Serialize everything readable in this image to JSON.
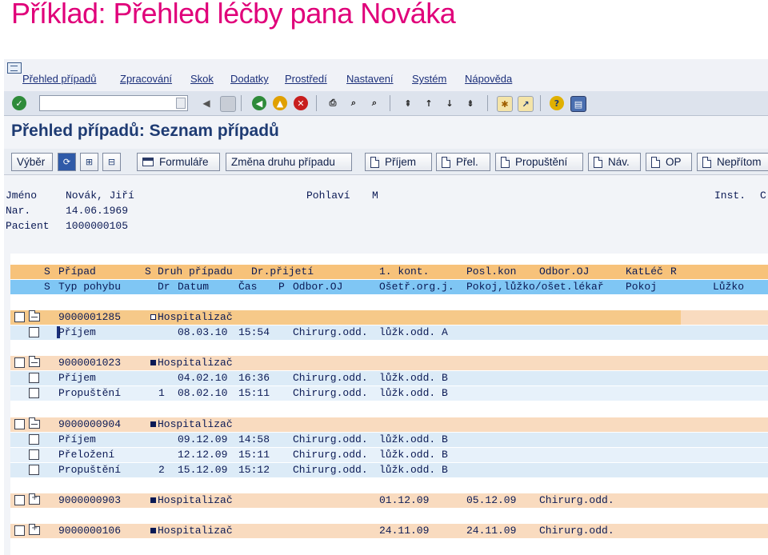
{
  "slide_title": "Příklad: Přehled léčby pana Nováka",
  "menu": [
    "Přehled případů",
    "Zpracování",
    "Skok",
    "Dodatky",
    "Prostředí",
    "Nastavení",
    "Systém",
    "Nápověda"
  ],
  "command_field": {
    "value": ""
  },
  "screen_title": "Přehled případů: Seznam případů",
  "app_toolbar": {
    "vyber": "Výběr",
    "formulare": "Formuláře",
    "zmena": "Změna druhu případu",
    "prijem": "Příjem",
    "prel": "Přel.",
    "propusteni": "Propuštění",
    "nav": "Náv.",
    "op": "OP",
    "nepritom": "Nepřítom"
  },
  "patient": {
    "name_label": "Jméno",
    "name": "Novák, Jiří",
    "sex_label": "Pohlaví",
    "sex": "M",
    "inst_label": "Inst.",
    "inst_value": "C",
    "dob_label": "Nar.",
    "dob": "14.06.1969",
    "patient_label": "Pacient",
    "patient_id": "1000000105"
  },
  "header_row1": [
    "S",
    "Případ",
    "S",
    "Druh případu",
    "Dr.přijetí",
    "1. kont.",
    "Posl.kon",
    "Odbor.OJ",
    "KatLéč",
    "R"
  ],
  "header_row2": [
    "S",
    "Typ pohybu",
    "Dr",
    "Datum",
    "Čas",
    "P",
    "Odbor.OJ",
    "Ošetř.org.j.",
    "Pokoj,lůžko/ošet.lékař",
    "Pokoj",
    "Lůžko"
  ],
  "cases": [
    {
      "id": "9000001285",
      "type": "Hospitalizač",
      "dr_prijeti": "",
      "kont": "",
      "posl": "",
      "movements": [
        {
          "typ": "Příjem",
          "p": "",
          "datum": "08.03.10",
          "cas": "15:54",
          "odbor": "Chirurg.odd.",
          "oset": "lůžk.odd. A"
        }
      ]
    },
    {
      "id": "9000001023",
      "type": "Hospitalizač",
      "dr_prijeti": "",
      "kont": "",
      "posl": "",
      "movements": [
        {
          "typ": "Příjem",
          "p": "",
          "datum": "04.02.10",
          "cas": "16:36",
          "odbor": "Chirurg.odd.",
          "oset": "lůžk.odd. B"
        },
        {
          "typ": "Propuštění",
          "p": "1",
          "datum": "08.02.10",
          "cas": "15:11",
          "odbor": "Chirurg.odd.",
          "oset": "lůžk.odd. B"
        }
      ]
    },
    {
      "id": "9000000904",
      "type": "Hospitalizač",
      "dr_prijeti": "",
      "kont": "",
      "posl": "",
      "movements": [
        {
          "typ": "Příjem",
          "p": "",
          "datum": "09.12.09",
          "cas": "14:58",
          "odbor": "Chirurg.odd.",
          "oset": "lůžk.odd. B"
        },
        {
          "typ": "Přeložení",
          "p": "",
          "datum": "12.12.09",
          "cas": "15:11",
          "odbor": "Chirurg.odd.",
          "oset": "lůžk.odd. B"
        },
        {
          "typ": "Propuštění",
          "p": "2",
          "datum": "15.12.09",
          "cas": "15:12",
          "odbor": "Chirurg.odd.",
          "oset": "lůžk.odd. B"
        }
      ]
    },
    {
      "id": "9000000903",
      "type": "Hospitalizač",
      "dr_prijeti": "",
      "kont": "01.12.09",
      "posl": "05.12.09",
      "odbor": "Chirurg.odd.",
      "movements": []
    },
    {
      "id": "9000000106",
      "type": "Hospitalizač",
      "dr_prijeti": "",
      "kont": "24.11.09",
      "posl": "24.11.09",
      "odbor": "Chirurg.odd.",
      "movements": []
    }
  ]
}
